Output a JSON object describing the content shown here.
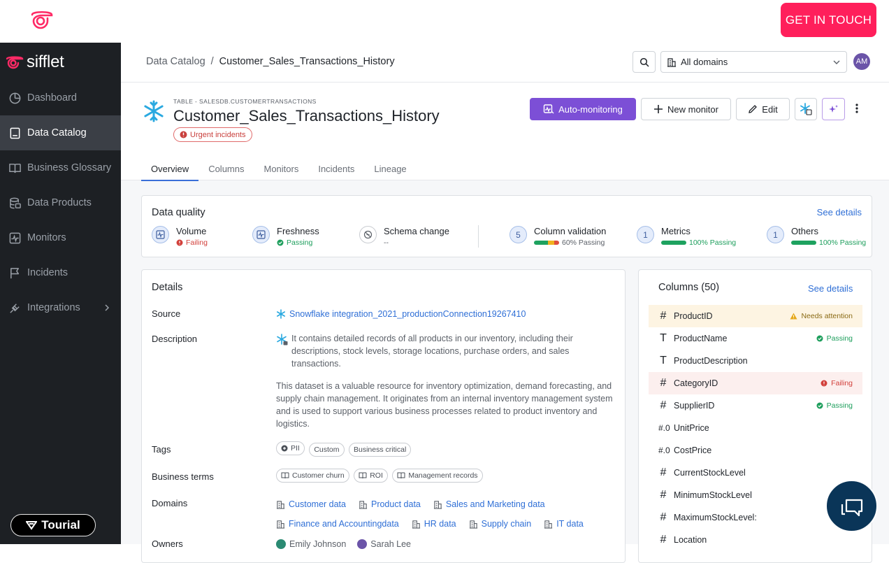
{
  "topbar": {
    "cta": "GET IN TOUCH"
  },
  "sidebar": {
    "brand": "sifflet",
    "items": [
      {
        "label": "Dashboard",
        "icon": "dashboard-icon"
      },
      {
        "label": "Data Catalog",
        "icon": "book-icon"
      },
      {
        "label": "Business Glossary",
        "icon": "open-book-icon"
      },
      {
        "label": "Data Products",
        "icon": "database-icon"
      },
      {
        "label": "Monitors",
        "icon": "pulse-icon"
      },
      {
        "label": "Incidents",
        "icon": "flag-icon"
      },
      {
        "label": "Integrations",
        "icon": "plug-icon"
      }
    ],
    "tourial": "Tourial"
  },
  "header": {
    "breadcrumb_root": "Data Catalog",
    "breadcrumb_sep": "/",
    "breadcrumb_current": "Customer_Sales_Transactions_History",
    "domain_select": "All domains",
    "avatar": "AM"
  },
  "asset": {
    "subtitle": "TABLE - SALESDB.CUSTOMERTRANSACTIONS",
    "title": "Customer_Sales_Transactions_History",
    "urgent": "Urgent incidents",
    "buttons": {
      "auto": "Auto-monitoring",
      "new": "New monitor",
      "edit": "Edit"
    },
    "tabs": [
      "Overview",
      "Columns",
      "Monitors",
      "Incidents",
      "Lineage"
    ]
  },
  "data_quality": {
    "title": "Data quality",
    "see": "See details",
    "items": [
      {
        "name": "Volume",
        "status": "Failing"
      },
      {
        "name": "Freshness",
        "status": "Passing"
      },
      {
        "name": "Schema change",
        "status": "--"
      },
      {
        "name": "Column validation",
        "count": "5",
        "status": "60% Passing"
      },
      {
        "name": "Metrics",
        "count": "1",
        "status": "100% Passing"
      },
      {
        "name": "Others",
        "count": "1",
        "status": "100% Passing"
      }
    ]
  },
  "details": {
    "title": "Details",
    "source_label": "Source",
    "source": "Snowflake integration_2021_productionConnection19267410",
    "description_label": "Description",
    "description_1": "It contains detailed records of all products in our inventory, including their descriptions, stock levels, storage locations, purchase orders, and sales transactions.",
    "description_2": "This dataset is a valuable resource for inventory optimization, demand forecasting, and supply chain management. It originates from an internal inventory management system and is used to support various business processes related to product inventory and logistics.",
    "tags_label": "Tags",
    "tags": [
      "PII",
      "Custom",
      "Business critical"
    ],
    "terms_label": "Business terms",
    "terms": [
      "Customer churn",
      "ROI",
      "Management records"
    ],
    "domains_label": "Domains",
    "domains": [
      "Customer data",
      "Product data",
      "Sales and Marketing data",
      "Finance and Accountingdata",
      "HR data",
      "Supply chain",
      "IT data"
    ],
    "owners_label": "Owners",
    "owners": [
      "Emily Johnson",
      "Sarah Lee"
    ]
  },
  "columns": {
    "title": "Columns (50)",
    "see": "See details",
    "rows": [
      {
        "type": "#",
        "name": "ProductID",
        "status": "Needs attention"
      },
      {
        "type": "T",
        "name": "ProductName",
        "status": "Passing"
      },
      {
        "type": "T",
        "name": "ProductDescription",
        "status": ""
      },
      {
        "type": "#",
        "name": "CategoryID",
        "status": "Failing"
      },
      {
        "type": "#",
        "name": "SupplierID",
        "status": "Passing"
      },
      {
        "type": "#.0",
        "name": "UnitPrice",
        "status": ""
      },
      {
        "type": "#.0",
        "name": "CostPrice",
        "status": ""
      },
      {
        "type": "#",
        "name": "CurrentStockLevel",
        "status": ""
      },
      {
        "type": "#",
        "name": "MinimumStockLevel",
        "status": ""
      },
      {
        "type": "#",
        "name": "MaximumStockLevel:",
        "status": ""
      },
      {
        "type": "#",
        "name": "Location",
        "status": ""
      }
    ]
  },
  "colors": {
    "accent": "#7c4fd6",
    "cta": "#ff1f5b",
    "link": "#2f6fd6",
    "sidebar": "#1d2024"
  }
}
